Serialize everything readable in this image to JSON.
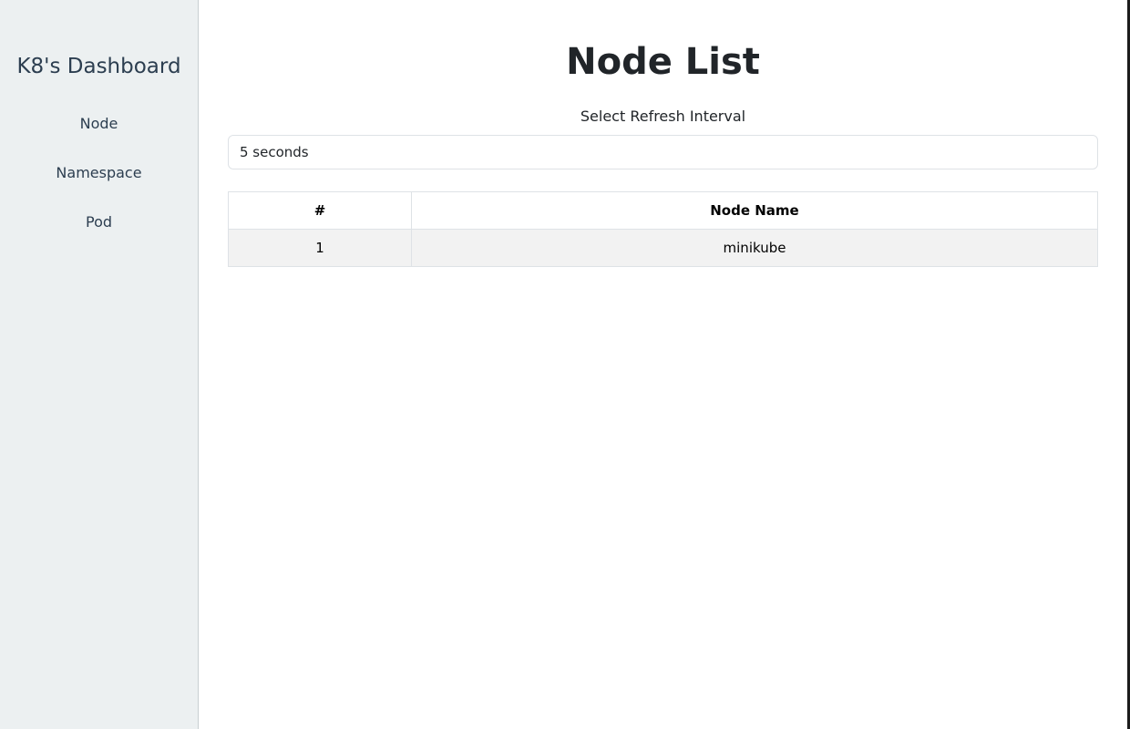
{
  "sidebar": {
    "brand": "K8's Dashboard",
    "items": [
      {
        "label": "Node"
      },
      {
        "label": "Namespace"
      },
      {
        "label": "Pod"
      }
    ]
  },
  "main": {
    "title": "Node List",
    "refresh": {
      "label": "Select Refresh Interval",
      "selected": "5 seconds"
    },
    "table": {
      "headers": [
        "#",
        "Node Name"
      ],
      "rows": [
        {
          "num": "1",
          "name": "minikube"
        }
      ]
    }
  }
}
